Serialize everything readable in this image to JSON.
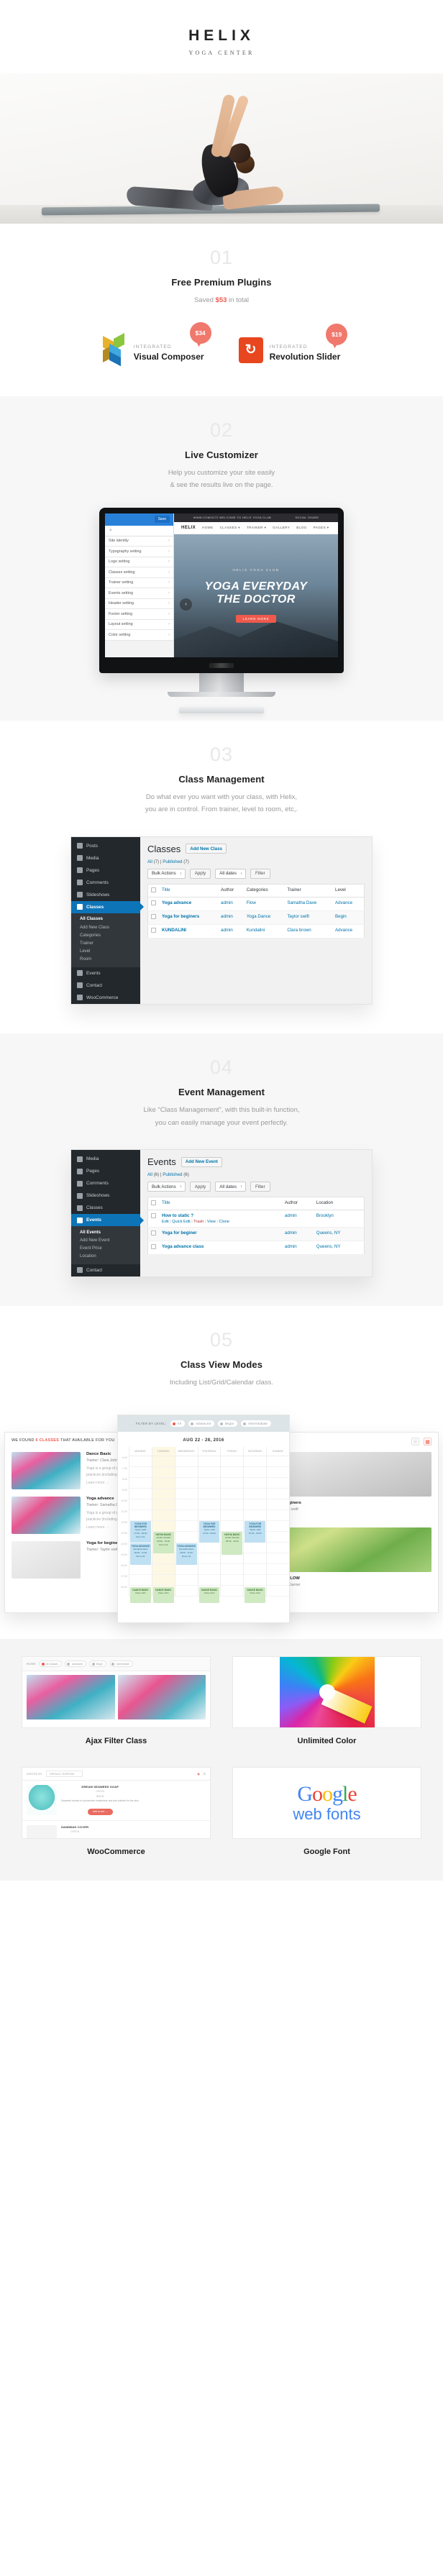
{
  "brand": {
    "name": "HELIX",
    "tagline": "YOGA CENTER"
  },
  "sections": [
    {
      "num": "01",
      "title": "Free Premium Plugins",
      "desc_pre": "Saved ",
      "desc_accent": "$53",
      "desc_post": " in total",
      "plugins": [
        {
          "kicker": "INTEGRATED",
          "name": "Visual Composer",
          "price": "$34",
          "icon": "visual-composer-logo"
        },
        {
          "kicker": "INTEGRATED",
          "name": "Revolution Slider",
          "price": "$19",
          "icon": "revolution-slider-logo"
        }
      ]
    },
    {
      "num": "02",
      "title": "Live Customizer",
      "desc_line1": "Help you customize your site easily",
      "desc_line2": "& see the results live on the page.",
      "customizer": {
        "save_label": "Save",
        "close_label": "×",
        "items": [
          "Site identity",
          "Typography setting",
          "Logo setting",
          "Classes setting",
          "Trainer setting",
          "Events setting",
          "Header setting",
          "Footer setting",
          "Layout setting",
          "Color setting"
        ]
      },
      "preview": {
        "topbar": [
          "WWW.COM/0172 WELCOME TO HELIX YOGA CLUB",
          "SOCIAL SHARE"
        ],
        "brand": "HELIX",
        "nav": [
          "HOME",
          "CLASSES ▾",
          "TRAINER ▾",
          "GALLERY",
          "BLOG",
          "PAGES ▾"
        ],
        "hero_kicker": "HELIX YOGA CLUB",
        "hero_line1": "YOGA EVERYDAY",
        "hero_line2": "THE DOCTOR",
        "hero_button": "LEARN MORE",
        "arrow": "‹"
      }
    },
    {
      "num": "03",
      "title": "Class Management",
      "desc_line1": "Do what ever you want with your class, with Helix,",
      "desc_line2": "you are in control. From trainer, level to room, etc,.",
      "admin": {
        "sidebar": [
          {
            "label": "Posts",
            "active": false
          },
          {
            "label": "Media",
            "active": false
          },
          {
            "label": "Pages",
            "active": false
          },
          {
            "label": "Comments",
            "active": false
          },
          {
            "label": "Slideshows",
            "active": false
          },
          {
            "label": "Classes",
            "active": true
          }
        ],
        "submenu": [
          "All Classes",
          "Add New Class",
          "Categories",
          "Trainer",
          "Level",
          "Room"
        ],
        "sidebar_after": [
          {
            "label": "Events",
            "active": false
          },
          {
            "label": "Contact",
            "active": false
          },
          {
            "label": "WooCommerce",
            "active": false
          }
        ],
        "page_title": "Classes",
        "add_new": "Add New Class",
        "subsub": [
          {
            "label": "All",
            "count": "(7)"
          },
          {
            "label": "Published",
            "count": "(7)"
          }
        ],
        "bulk_actions": "Bulk Actions",
        "apply": "Apply",
        "all_dates": "All dates",
        "filter": "Filter",
        "columns": [
          "Title",
          "Author",
          "Categories",
          "Trainer",
          "Level"
        ],
        "rows": [
          {
            "title": "Yoga advance",
            "author": "admin",
            "category": "Flow",
            "trainer": "Samatha Dave",
            "level": "Advance"
          },
          {
            "title": "Yoga for beginers",
            "author": "admin",
            "category": "Yoga Dance",
            "trainer": "Taylor swift",
            "level": "Begin"
          },
          {
            "title": "KUNDALINI",
            "author": "admin",
            "category": "Kundalini",
            "trainer": "Clara brown",
            "level": "Advance"
          }
        ]
      }
    },
    {
      "num": "04",
      "title": "Event Management",
      "desc_line1": "Like “Class Management”, with this built-in function,",
      "desc_line2": "you can easily manage your event perfectly.",
      "admin": {
        "sidebar": [
          {
            "label": "Media",
            "active": false
          },
          {
            "label": "Pages",
            "active": false
          },
          {
            "label": "Comments",
            "active": false
          },
          {
            "label": "Slideshows",
            "active": false
          },
          {
            "label": "Classes",
            "active": false
          },
          {
            "label": "Events",
            "active": true
          }
        ],
        "submenu": [
          "All Events",
          "Add New Event",
          "Event Price",
          "Location"
        ],
        "sidebar_after": [
          {
            "label": "Contact",
            "active": false
          }
        ],
        "page_title": "Events",
        "add_new": "Add New Event",
        "subsub": [
          {
            "label": "All",
            "count": "(6)"
          },
          {
            "label": "Published",
            "count": "(6)"
          }
        ],
        "bulk_actions": "Bulk Actions",
        "apply": "Apply",
        "all_dates": "All dates",
        "filter": "Filter",
        "columns": [
          "Title",
          "Author",
          "Location"
        ],
        "row_actions": [
          "Edit",
          "Quick Edit",
          "Trash",
          "View",
          "Clone"
        ],
        "rows": [
          {
            "title": "How to static ?",
            "author": "admin",
            "location": "Brooklyn"
          },
          {
            "title": "Yoga for beginer",
            "author": "admin",
            "location": "Queens, NY"
          },
          {
            "title": "Yoga advance class",
            "author": "admin",
            "location": "Queens, NY"
          }
        ]
      }
    },
    {
      "num": "05",
      "title": "Class View Modes",
      "desc_line1": "Including List/Grid/Calendar class.",
      "list_view": {
        "header_pre": "WE FOUND ",
        "header_accent": "6 CLASSES",
        "header_post": " THAT AVAILABLE FOR YOU",
        "items": [
          {
            "title": "Dance Basic",
            "trainer": "Trainer: Clara John",
            "excerpt": "Yoga is a group of physical, mental and spiritual practices (including)",
            "more": "Learn more →"
          },
          {
            "title": "Yoga advance",
            "trainer": "Trainer: Samatha Dave",
            "excerpt": "Yoga is a group of physical, mental and spiritual practices (including)",
            "more": "Learn more →"
          },
          {
            "title": "Yoga for beginers",
            "trainer": "Trainer: Taylor swift",
            "excerpt": "",
            "more": ""
          }
        ]
      },
      "grid_view": {
        "items": [
          {
            "title": "Yoga for beginers",
            "trainer": "Trainer: Taylor swift",
            "more": "Learn more →"
          },
          {
            "title": "ADVANCE FLOW",
            "trainer": "Trainer: Jane Garner",
            "more": "Learn more →"
          }
        ]
      },
      "calendar_view": {
        "filter_label": "FILTER BY LEVEL:",
        "filters": [
          "All",
          "Advanced",
          "Begin",
          "Intermediate"
        ],
        "date_range": "AUG 22 - 28, 2016",
        "days": [
          "MONDAY",
          "TUESDAY",
          "WEDNESDAY",
          "THURSDAY",
          "FRIDAY",
          "SATURDAY",
          "SUNDAY"
        ],
        "hours": [
          "6:00",
          "7:00",
          "8:00",
          "9:00",
          "10:00",
          "11:00",
          "12:00",
          "13:00",
          "14:00",
          "15:00",
          "16:00",
          "17:00",
          "18:00"
        ],
        "events": [
          {
            "name": "YOGA FOR BEGINERS",
            "trainer": "Taylor swift",
            "time": "07:00 - 09:00",
            "room": "Room 01",
            "day": 0,
            "color": "blue"
          },
          {
            "name": "YOGA ADVANCE",
            "trainer": "Samatha Dave",
            "time": "09:00 - 11:00",
            "room": "Room 01",
            "day": 0,
            "color": "blue"
          },
          {
            "name": "HATHA BASIC",
            "trainer": "Jenifer Mueller",
            "time": "08:30 - 10:30",
            "room": "Room 02",
            "day": 1,
            "color": "green"
          },
          {
            "name": "YOGA ADVANCE",
            "trainer": "Samatha Dave",
            "time": "09:00 - 11:00",
            "room": "Room 01",
            "day": 2,
            "color": "blue"
          },
          {
            "name": "YOGA FOR BEGINERS",
            "trainer": "Taylor swift",
            "time": "07:00 - 09:00",
            "room": "Room 01",
            "day": 3,
            "color": "blue"
          },
          {
            "name": "HATHA BASIC",
            "trainer": "Jenifer Mueller",
            "time": "08:30 - 10:30",
            "room": "Room 02",
            "day": 4,
            "color": "green"
          },
          {
            "name": "DANCE BASIC",
            "trainer": "Clara John",
            "time": "",
            "room": "",
            "day": 0,
            "color": "green"
          }
        ]
      }
    }
  ],
  "features": [
    {
      "caption": "Ajax Filter Class",
      "icon": "ajax-filter-preview",
      "filter_label": "FILTER:",
      "filters": [
        "All Classes",
        "Advanced",
        "Begin",
        "Inermediate"
      ]
    },
    {
      "caption": "Unlimited Color",
      "icon": "color-wheel"
    },
    {
      "caption": "WooCommerce",
      "icon": "woocommerce-shop-preview",
      "sorted_by": "SORTED BY:",
      "sorting": "DEFAULT SORTING",
      "products": [
        {
          "name": "DREAM SEAWEED SOAP",
          "cat": "GREEN",
          "price": "$15.00",
          "desc": "Seaweed extract is a protective moisturizer and and nutrient for the skin.",
          "button": "Add to cart →"
        },
        {
          "name": "SANDBAG COVER",
          "cat": "GREEN",
          "price": "",
          "desc": "",
          "button": ""
        }
      ]
    },
    {
      "caption": "Google Font",
      "icon": "google-web-fonts-logo",
      "logo_line1": "Google",
      "logo_line2": "web fonts"
    }
  ],
  "colors": {
    "accent": "#ef5a4c",
    "badge": "#f0786c",
    "wp_blue": "#0073aa",
    "wp_sidebar": "#23282d",
    "grey_bg": "#f7f7f7"
  }
}
